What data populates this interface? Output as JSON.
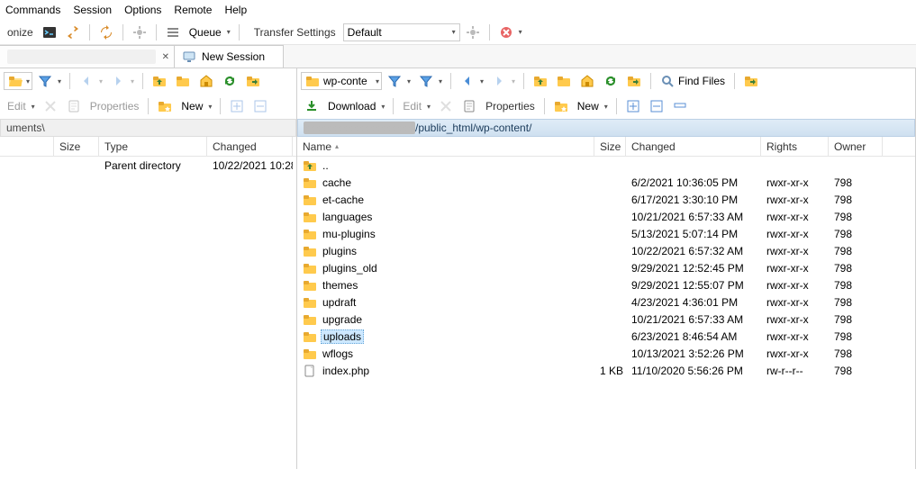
{
  "menu": [
    "Commands",
    "Session",
    "Options",
    "Remote",
    "Help"
  ],
  "toolbar1": {
    "sync_label": "onize",
    "queue_label": "Queue",
    "transfer_label": "Transfer Settings",
    "transfer_value": "Default"
  },
  "tabs": {
    "new_session": "New Session"
  },
  "left": {
    "dir_dropdown": "",
    "actions": {
      "edit": "Edit",
      "properties": "Properties",
      "new": "New"
    },
    "path": "uments\\",
    "cols": {
      "size": "Size",
      "type": "Type",
      "changed": "Changed"
    },
    "rows": [
      {
        "type": "Parent directory",
        "changed": "10/22/2021 10:28"
      }
    ]
  },
  "right": {
    "dir_dropdown": "wp-conte",
    "find": "Find Files",
    "actions": {
      "download": "Download",
      "edit": "Edit",
      "properties": "Properties",
      "new": "New"
    },
    "path_suffix": "/public_html/wp-content/",
    "cols": {
      "name": "Name",
      "size": "Size",
      "changed": "Changed",
      "rights": "Rights",
      "owner": "Owner"
    },
    "rows": [
      {
        "name": "..",
        "icon": "up",
        "size": "",
        "changed": "",
        "rights": "",
        "owner": ""
      },
      {
        "name": "cache",
        "icon": "folder",
        "size": "",
        "changed": "6/2/2021 10:36:05 PM",
        "rights": "rwxr-xr-x",
        "owner": "798"
      },
      {
        "name": "et-cache",
        "icon": "folder",
        "size": "",
        "changed": "6/17/2021 3:30:10 PM",
        "rights": "rwxr-xr-x",
        "owner": "798"
      },
      {
        "name": "languages",
        "icon": "folder",
        "size": "",
        "changed": "10/21/2021 6:57:33 AM",
        "rights": "rwxr-xr-x",
        "owner": "798"
      },
      {
        "name": "mu-plugins",
        "icon": "folder",
        "size": "",
        "changed": "5/13/2021 5:07:14 PM",
        "rights": "rwxr-xr-x",
        "owner": "798"
      },
      {
        "name": "plugins",
        "icon": "folder",
        "size": "",
        "changed": "10/22/2021 6:57:32 AM",
        "rights": "rwxr-xr-x",
        "owner": "798"
      },
      {
        "name": "plugins_old",
        "icon": "folder",
        "size": "",
        "changed": "9/29/2021 12:52:45 PM",
        "rights": "rwxr-xr-x",
        "owner": "798"
      },
      {
        "name": "themes",
        "icon": "folder",
        "size": "",
        "changed": "9/29/2021 12:55:07 PM",
        "rights": "rwxr-xr-x",
        "owner": "798"
      },
      {
        "name": "updraft",
        "icon": "folder",
        "size": "",
        "changed": "4/23/2021 4:36:01 PM",
        "rights": "rwxr-xr-x",
        "owner": "798"
      },
      {
        "name": "upgrade",
        "icon": "folder",
        "size": "",
        "changed": "10/21/2021 6:57:33 AM",
        "rights": "rwxr-xr-x",
        "owner": "798"
      },
      {
        "name": "uploads",
        "icon": "folder",
        "size": "",
        "changed": "6/23/2021 8:46:54 AM",
        "rights": "rwxr-xr-x",
        "owner": "798",
        "selected": true
      },
      {
        "name": "wflogs",
        "icon": "folder",
        "size": "",
        "changed": "10/13/2021 3:52:26 PM",
        "rights": "rwxr-xr-x",
        "owner": "798"
      },
      {
        "name": "index.php",
        "icon": "file",
        "size": "1 KB",
        "changed": "11/10/2020 5:56:26 PM",
        "rights": "rw-r--r--",
        "owner": "798"
      }
    ]
  }
}
